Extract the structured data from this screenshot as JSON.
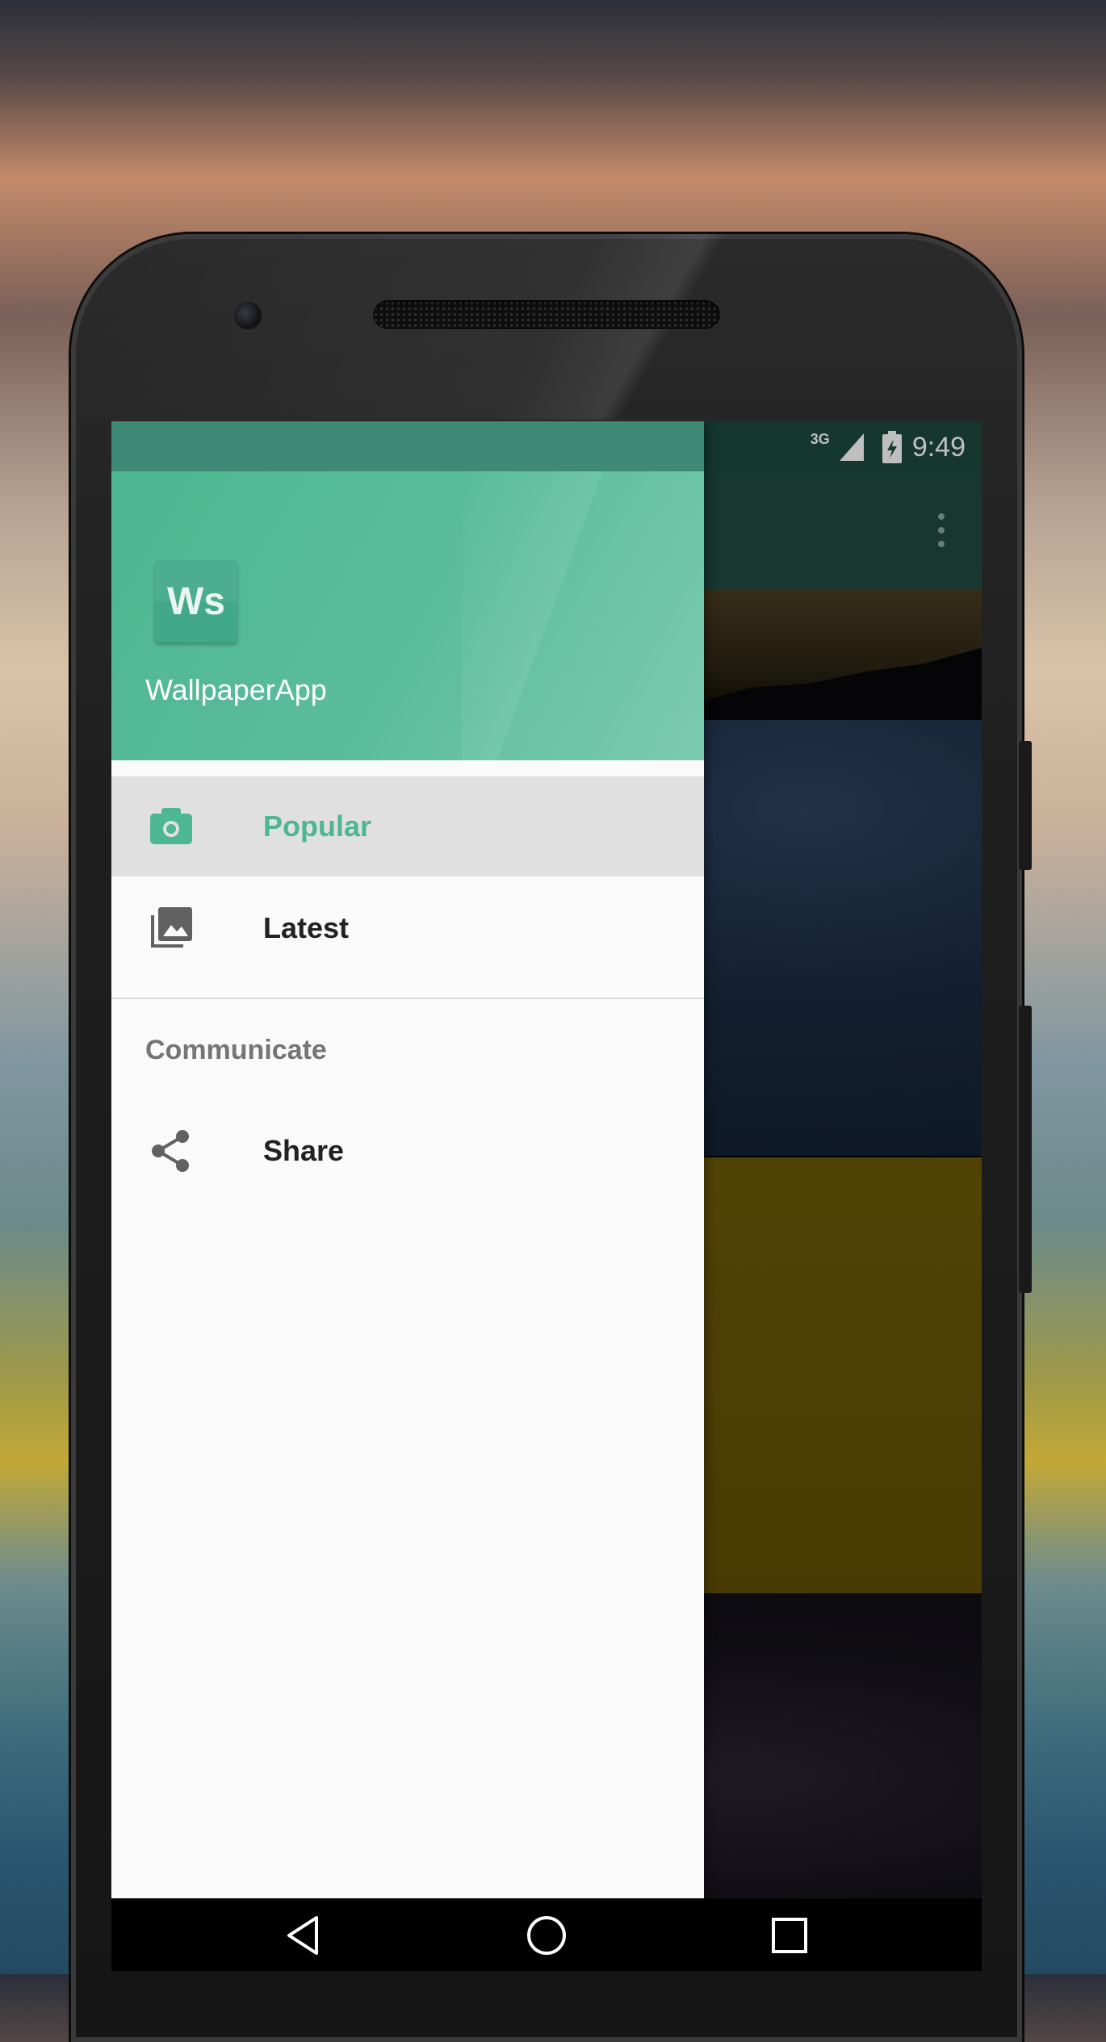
{
  "status_bar": {
    "network": "3G",
    "time": "9:49"
  },
  "drawer": {
    "header": {
      "logo_text": "Ws",
      "app_name": "WallpaperApp"
    },
    "items": [
      {
        "label": "Popular",
        "icon": "camera-icon",
        "selected": true
      },
      {
        "label": "Latest",
        "icon": "photo-library-icon",
        "selected": false
      }
    ],
    "section": {
      "title": "Communicate",
      "items": [
        {
          "label": "Share",
          "icon": "share-icon"
        }
      ]
    }
  },
  "colors": {
    "accent": "#4db692",
    "header_gradient_end": "#7ccbb1",
    "app_bar": "#1f4a40",
    "selected_bg": "#e0e0e0"
  },
  "navigation": [
    "back-icon",
    "home-icon",
    "recents-icon"
  ]
}
